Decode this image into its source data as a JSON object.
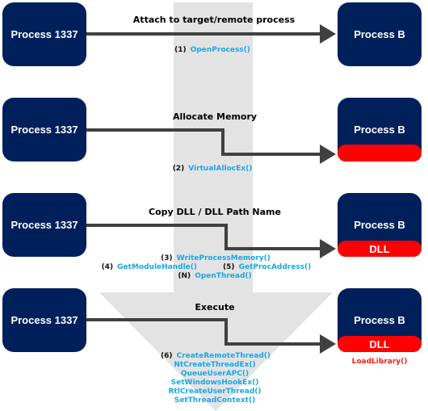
{
  "steps": [
    {
      "source": "Process 1337",
      "target": "Process B",
      "title": "Attach to target/remote process",
      "calls": [
        {
          "num": "(1)",
          "fn": "OpenProcess()"
        }
      ]
    },
    {
      "source": "Process 1337",
      "target": "Process B",
      "title": "Allocate Memory",
      "calls": [
        {
          "num": "(2)",
          "fn": "VirtualAllocEx()"
        }
      ]
    },
    {
      "source": "Process 1337",
      "target": "Process B",
      "target_module": "DLL",
      "title": "Copy DLL / DLL Path Name",
      "calls": [
        {
          "num": "(3)",
          "fn": "WriteProcessMemory()"
        },
        {
          "num": "(4)",
          "fn": "GetModuleHandle()"
        },
        {
          "num": "(5)",
          "fn": "GetProcAddress()"
        },
        {
          "num": "(N)",
          "fn": "OpenThread()"
        }
      ]
    },
    {
      "source": "Process 1337",
      "target": "Process B",
      "target_module": "DLL",
      "target_note": "LoadLibrary()",
      "title": "Execute",
      "calls": [
        {
          "num": "(6)",
          "fn": "CreateRemoteThread()"
        },
        {
          "fn": "NtCreateThreadEx()"
        },
        {
          "fn": "QueueUserAPC()"
        },
        {
          "fn": "SetWindowsHookEx()"
        },
        {
          "fn": "RtlCreateUserThread()"
        },
        {
          "fn": "SetThreadContext()"
        }
      ]
    }
  ],
  "colors": {
    "process_box": "#00205b",
    "dll_block": "#ff0000",
    "api_text": "#1aa7e8",
    "flow_arrow": "#e3e3e3",
    "connector": "#404040"
  }
}
